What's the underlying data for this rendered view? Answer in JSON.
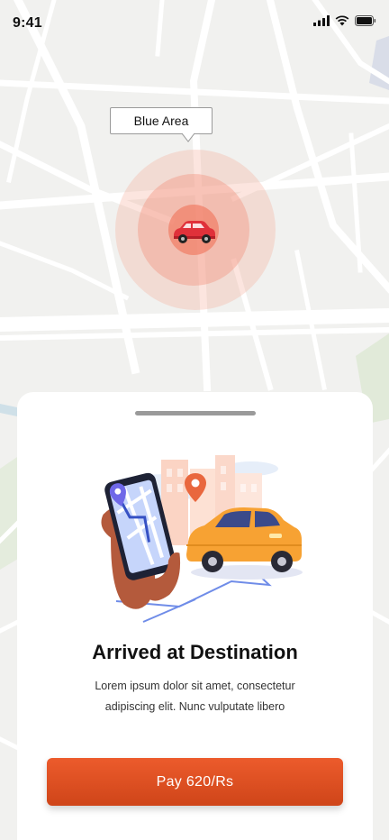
{
  "status_bar": {
    "time": "9:41"
  },
  "map": {
    "location_label": "Blue Area"
  },
  "sheet": {
    "title": "Arrived at Destination",
    "description": "Lorem ipsum dolor sit amet, consectetur adipiscing elit. Nunc vulputate libero",
    "pay_label": "Pay 620/Rs"
  },
  "colors": {
    "accent": "#e65428",
    "pulse": "#f28c76",
    "map_background": "#f1f1ef",
    "map_road": "#ffffff"
  },
  "icons": [
    "signal-icon",
    "wifi-icon",
    "battery-icon",
    "car-icon"
  ]
}
